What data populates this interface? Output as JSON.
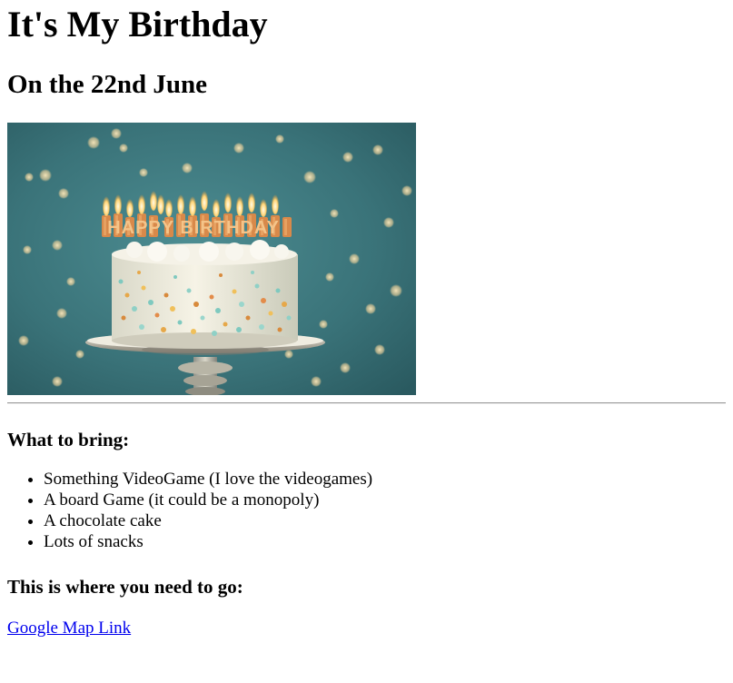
{
  "title": "It's My Birthday",
  "subtitle": "On the 22nd June",
  "hero_image": {
    "icon": "birthday-cake-image",
    "candle_text": "HAPPY BIRTHDAY",
    "colors": {
      "background": "#3b7a80",
      "bokeh": "#f2d9a0",
      "frosting": "#f3eee1",
      "candle_gold": "#d8894a"
    }
  },
  "bring": {
    "heading": "What to bring:",
    "items": [
      "Something VideoGame (I love the videogames)",
      "A board Game (it could be a monopoly)",
      "A chocolate cake",
      "Lots of snacks"
    ]
  },
  "where": {
    "heading": "This is where you need to go:",
    "link_label": "Google Map Link"
  },
  "colors": {
    "link": "#0000ee",
    "text": "#000000"
  }
}
